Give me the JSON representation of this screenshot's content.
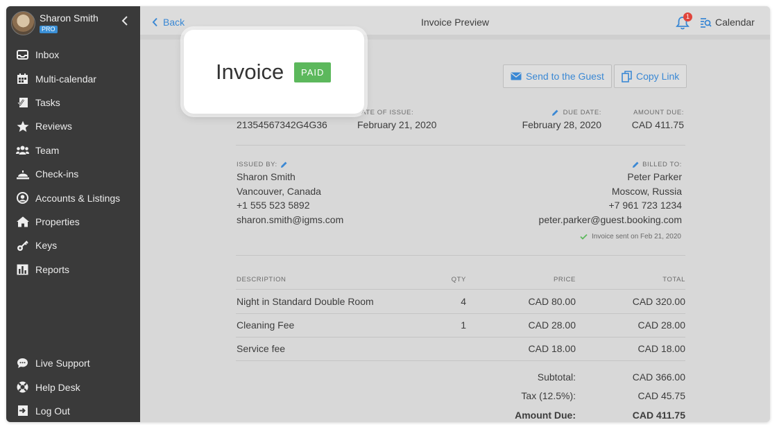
{
  "profile": {
    "name": "Sharon Smith",
    "badge": "PRO"
  },
  "sidebar": {
    "items": [
      {
        "label": "Inbox",
        "icon": "inbox-icon"
      },
      {
        "label": "Multi-calendar",
        "icon": "calendar-grid-icon"
      },
      {
        "label": "Tasks",
        "icon": "tasks-icon"
      },
      {
        "label": "Reviews",
        "icon": "star-icon"
      },
      {
        "label": "Team",
        "icon": "team-icon"
      },
      {
        "label": "Check-ins",
        "icon": "bell-desk-icon"
      },
      {
        "label": "Accounts & Listings",
        "icon": "account-circle-icon"
      },
      {
        "label": "Properties",
        "icon": "home-icon"
      },
      {
        "label": "Keys",
        "icon": "key-icon"
      },
      {
        "label": "Reports",
        "icon": "bar-chart-icon"
      }
    ],
    "bottom": [
      {
        "label": "Live Support",
        "icon": "chat-icon"
      },
      {
        "label": "Help Desk",
        "icon": "lifebuoy-icon"
      },
      {
        "label": "Log Out",
        "icon": "logout-icon"
      }
    ]
  },
  "topbar": {
    "back": "Back",
    "title": "Invoice Preview",
    "notification_count": "1",
    "calendar": "Calendar"
  },
  "popup": {
    "title": "Invoice",
    "status": "PAID"
  },
  "actions": {
    "send": "Send to the Guest",
    "copy": "Copy Link"
  },
  "invoice": {
    "number": "21354567342G4G36",
    "issue_date_label": "ATE OF ISSUE:",
    "issue_date": "February 21, 2020",
    "due_date_label": "DUE DATE:",
    "due_date": "February 28, 2020",
    "amount_due_label": "AMOUNT DUE:",
    "amount_due": "CAD 411.75",
    "issued_by_label": "ISSUED BY:",
    "issuer": {
      "name": "Sharon Smith",
      "location": "Vancouver, Canada",
      "phone": "+1 555 523 5892",
      "email": "sharon.smith@igms.com"
    },
    "billed_to_label": "BILLED TO:",
    "billed": {
      "name": "Peter Parker",
      "location": "Moscow, Russia",
      "phone": "+7 961 723 1234",
      "email": "peter.parker@guest.booking.com"
    },
    "sent_note": "Invoice sent on Feb 21, 2020",
    "columns": {
      "description": "DESCRIPTION",
      "qty": "QTY",
      "price": "PRICE",
      "total": "TOTAL"
    },
    "rows": [
      {
        "description": "Night in Standard Double Room",
        "qty": "4",
        "price": "CAD 80.00",
        "total": "CAD 320.00"
      },
      {
        "description": "Cleaning Fee",
        "qty": "1",
        "price": "CAD 28.00",
        "total": "CAD 28.00"
      },
      {
        "description": "Service fee",
        "qty": "",
        "price": "CAD 18.00",
        "total": "CAD 18.00"
      }
    ],
    "summary": {
      "subtotal_label": "Subtotal:",
      "subtotal": "CAD 366.00",
      "tax_label": "Tax (12.5%):",
      "tax": "CAD 45.75",
      "amount_due_label": "Amount Due:",
      "amount_due": "CAD 411.75"
    }
  },
  "colors": {
    "accent": "#3a88d4",
    "paid": "#5cb85c",
    "sidebar": "#3a3a3a",
    "badge": "#e0453c"
  }
}
